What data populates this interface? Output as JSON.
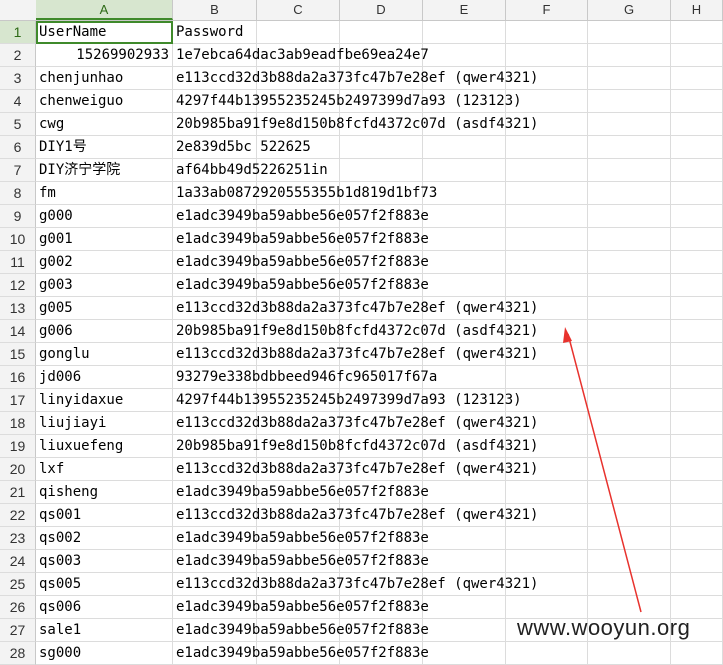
{
  "columns": [
    "A",
    "B",
    "C",
    "D",
    "E",
    "F",
    "G",
    "H"
  ],
  "rows": [
    {
      "n": "1",
      "a": "UserName",
      "b": "Password"
    },
    {
      "n": "2",
      "a": "15269902933",
      "b": "1e7ebca64dac3ab9eadfbe69ea24e7",
      "num": true
    },
    {
      "n": "3",
      "a": "chenjunhao",
      "b": "e113ccd32d3b88da2a373fc47b7e28ef (qwer4321)"
    },
    {
      "n": "4",
      "a": "chenweiguo",
      "b": "4297f44b13955235245b2497399d7a93 (123123)"
    },
    {
      "n": "5",
      "a": "cwg",
      "b": "20b985ba91f9e8d150b8fcfd4372c07d (asdf4321)"
    },
    {
      "n": "6",
      "a": "DIY1号",
      "b": "2e839d5bc   522625"
    },
    {
      "n": "7",
      "a": "DIY济宁学院",
      "b": "af64bb49d5226251in"
    },
    {
      "n": "8",
      "a": "fm",
      "b": "1a33ab0872920555355b1d819d1bf73"
    },
    {
      "n": "9",
      "a": "g000",
      "b": "e1adc3949ba59abbe56e057f2f883e"
    },
    {
      "n": "10",
      "a": "g001",
      "b": "e1adc3949ba59abbe56e057f2f883e"
    },
    {
      "n": "11",
      "a": "g002",
      "b": "e1adc3949ba59abbe56e057f2f883e"
    },
    {
      "n": "12",
      "a": "g003",
      "b": "e1adc3949ba59abbe56e057f2f883e"
    },
    {
      "n": "13",
      "a": "g005",
      "b": "e113ccd32d3b88da2a373fc47b7e28ef (qwer4321)"
    },
    {
      "n": "14",
      "a": "g006",
      "b": "20b985ba91f9e8d150b8fcfd4372c07d (asdf4321)"
    },
    {
      "n": "15",
      "a": "gonglu",
      "b": "e113ccd32d3b88da2a373fc47b7e28ef (qwer4321)"
    },
    {
      "n": "16",
      "a": "jd006",
      "b": "93279e338bdbbeed946fc965017f67a"
    },
    {
      "n": "17",
      "a": "linyidaxue",
      "b": "4297f44b13955235245b2497399d7a93 (123123)"
    },
    {
      "n": "18",
      "a": "liujiayi",
      "b": "e113ccd32d3b88da2a373fc47b7e28ef (qwer4321)"
    },
    {
      "n": "19",
      "a": "liuxuefeng",
      "b": "20b985ba91f9e8d150b8fcfd4372c07d (asdf4321)"
    },
    {
      "n": "20",
      "a": "lxf",
      "b": "e113ccd32d3b88da2a373fc47b7e28ef (qwer4321)"
    },
    {
      "n": "21",
      "a": "qisheng",
      "b": "e1adc3949ba59abbe56e057f2f883e"
    },
    {
      "n": "22",
      "a": "qs001",
      "b": "e113ccd32d3b88da2a373fc47b7e28ef (qwer4321)"
    },
    {
      "n": "23",
      "a": "qs002",
      "b": "e1adc3949ba59abbe56e057f2f883e"
    },
    {
      "n": "24",
      "a": "qs003",
      "b": "e1adc3949ba59abbe56e057f2f883e"
    },
    {
      "n": "25",
      "a": "qs005",
      "b": "e113ccd32d3b88da2a373fc47b7e28ef (qwer4321)"
    },
    {
      "n": "26",
      "a": "qs006",
      "b": "e1adc3949ba59abbe56e057f2f883e"
    },
    {
      "n": "27",
      "a": "sale1",
      "b": "e1adc3949ba59abbe56e057f2f883e"
    },
    {
      "n": "28",
      "a": "sg000",
      "b": "e1adc3949ba59abbe56e057f2f883e"
    }
  ],
  "watermark": "www.wooyun.org",
  "colors": {
    "annotation_arrow": "#e8322d",
    "header_active": "#d7e6cf",
    "grid": "#dcdcdc"
  }
}
